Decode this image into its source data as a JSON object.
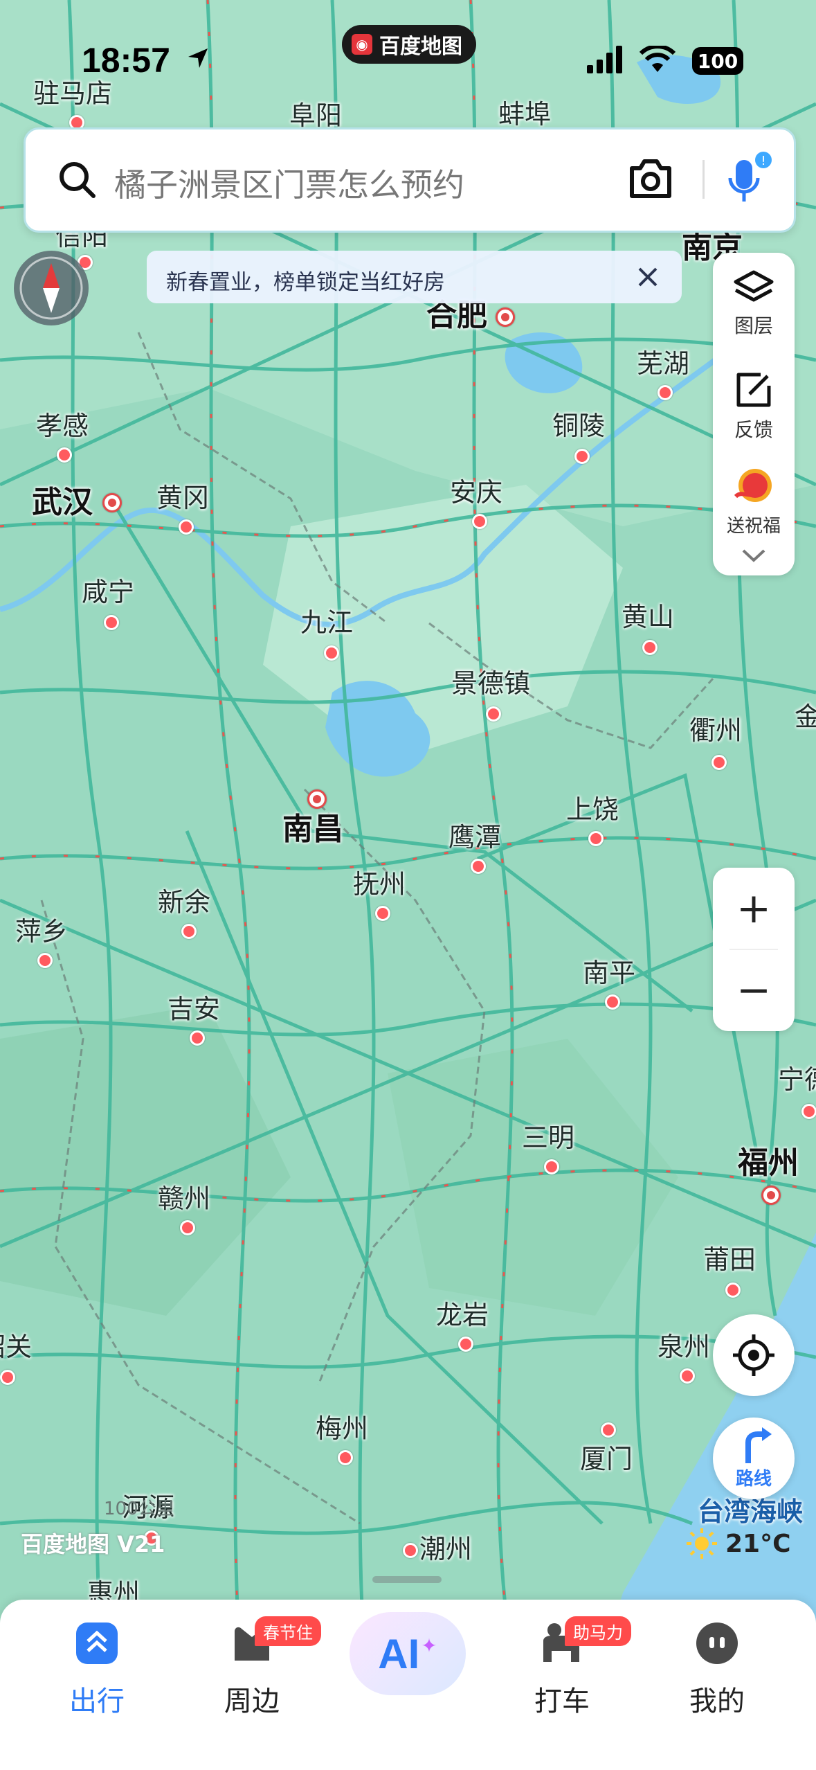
{
  "status_bar": {
    "time": "18:57",
    "app_pill": "百度地图",
    "battery": "100"
  },
  "search": {
    "placeholder": "橘子洲景区门票怎么预约"
  },
  "banner": {
    "text": "新春置业，榜单锁定当红好房"
  },
  "tools": {
    "layers": "图层",
    "feedback": "反馈",
    "blessing": "送祝福"
  },
  "map": {
    "watermark": "百度地图 V21",
    "scale_label": "100公里",
    "sea_label": "台湾海峡",
    "cities": [
      {
        "name": "驻马店",
        "major": false
      },
      {
        "name": "阜阳",
        "major": false
      },
      {
        "name": "蚌埠",
        "major": false
      },
      {
        "name": "信阳",
        "major": false
      },
      {
        "name": "南京",
        "major": true
      },
      {
        "name": "合肥",
        "major": true
      },
      {
        "name": "芜湖",
        "major": false
      },
      {
        "name": "孝感",
        "major": false
      },
      {
        "name": "铜陵",
        "major": false
      },
      {
        "name": "武汉",
        "major": true
      },
      {
        "name": "黄冈",
        "major": false
      },
      {
        "name": "安庆",
        "major": false
      },
      {
        "name": "咸宁",
        "major": false
      },
      {
        "name": "九江",
        "major": false
      },
      {
        "name": "黄山",
        "major": false
      },
      {
        "name": "景德镇",
        "major": false
      },
      {
        "name": "衢州",
        "major": false
      },
      {
        "name": "金",
        "major": false
      },
      {
        "name": "南昌",
        "major": true
      },
      {
        "name": "上饶",
        "major": false
      },
      {
        "name": "鹰潭",
        "major": false
      },
      {
        "name": "抚州",
        "major": false
      },
      {
        "name": "新余",
        "major": false
      },
      {
        "name": "萍乡",
        "major": false
      },
      {
        "name": "南平",
        "major": false
      },
      {
        "name": "吉安",
        "major": false
      },
      {
        "name": "宁德",
        "major": false
      },
      {
        "name": "三明",
        "major": false
      },
      {
        "name": "福州",
        "major": true
      },
      {
        "name": "赣州",
        "major": false
      },
      {
        "name": "莆田",
        "major": false
      },
      {
        "name": "龙岩",
        "major": false
      },
      {
        "name": "泉州",
        "major": false
      },
      {
        "name": "韶关",
        "major": false
      },
      {
        "name": "梅州",
        "major": false
      },
      {
        "name": "厦门",
        "major": false
      },
      {
        "name": "河源",
        "major": false
      },
      {
        "name": "潮州",
        "major": false
      },
      {
        "name": "惠州",
        "major": false
      }
    ]
  },
  "zoom": {
    "in": "+",
    "out": "−"
  },
  "route": {
    "label": "路线"
  },
  "weather": {
    "temp": "21°C"
  },
  "nav": {
    "items": [
      {
        "label": "出行",
        "badge": ""
      },
      {
        "label": "周边",
        "badge": "春节住"
      },
      {
        "label": "AI",
        "badge": ""
      },
      {
        "label": "打车",
        "badge": "助马力"
      },
      {
        "label": "我的",
        "badge": ""
      }
    ]
  },
  "colors": {
    "accent": "#2f7cf6",
    "map_land": "#9ad9c0",
    "map_sea": "#8fd0f0",
    "road": "#43b89c",
    "city_dot": "#ff5a5f"
  }
}
